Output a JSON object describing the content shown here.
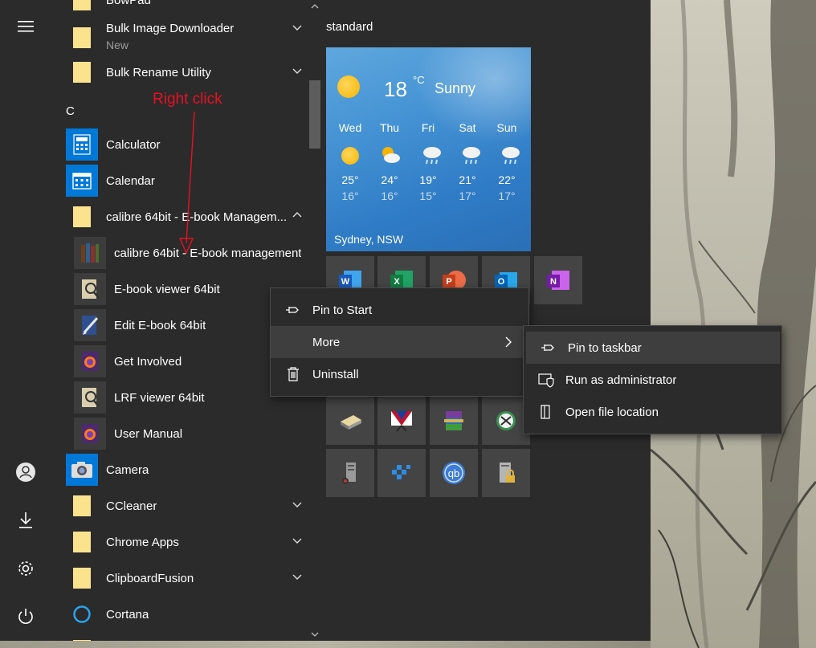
{
  "left_rail": {
    "menu_icon": "hamburger-icon",
    "account_icon": "user-icon",
    "downloads_icon": "download-icon",
    "settings_icon": "gear-icon",
    "power_icon": "power-icon"
  },
  "app_list": {
    "items": [
      {
        "label": "BowPad",
        "type": "folder",
        "chevron": false
      },
      {
        "label": "Bulk Image Downloader",
        "sublabel": "New",
        "type": "folder",
        "chevron": true
      },
      {
        "label": "Bulk Rename Utility",
        "type": "folder",
        "chevron": true
      },
      {
        "letter": "C"
      },
      {
        "label": "Calculator",
        "type": "app"
      },
      {
        "label": "Calendar",
        "type": "app"
      },
      {
        "label": "calibre 64bit - E-book Managem...",
        "type": "folder",
        "chevron": "up"
      },
      {
        "label": "calibre 64bit - E-book management",
        "type": "sub"
      },
      {
        "label": "E-book viewer 64bit",
        "type": "sub"
      },
      {
        "label": "Edit E-book 64bit",
        "type": "sub"
      },
      {
        "label": "Get Involved",
        "type": "sub"
      },
      {
        "label": "LRF viewer 64bit",
        "type": "sub"
      },
      {
        "label": "User Manual",
        "type": "sub"
      },
      {
        "label": "Camera",
        "type": "app"
      },
      {
        "label": "CCleaner",
        "type": "folder",
        "chevron": true
      },
      {
        "label": "Chrome Apps",
        "type": "folder",
        "chevron": true
      },
      {
        "label": "ClipboardFusion",
        "type": "folder",
        "chevron": true
      },
      {
        "label": "Cortana",
        "type": "app"
      }
    ]
  },
  "annotation": {
    "text": "Right click",
    "color": "#e81123"
  },
  "tiles": {
    "group_title": "standard",
    "weather": {
      "temp": "18",
      "unit": "°C",
      "condition": "Sunny",
      "location": "Sydney, NSW",
      "forecast": [
        {
          "day": "Wed",
          "icon": "sun-icon",
          "high": "25°",
          "low": "16°"
        },
        {
          "day": "Thu",
          "icon": "partly-cloudy-icon",
          "high": "24°",
          "low": "16°"
        },
        {
          "day": "Fri",
          "icon": "rain-cloud-icon",
          "high": "19°",
          "low": "15°"
        },
        {
          "day": "Sat",
          "icon": "rain-cloud-icon",
          "high": "21°",
          "low": "17°"
        },
        {
          "day": "Sun",
          "icon": "rain-cloud-icon",
          "high": "22°",
          "low": "17°"
        }
      ]
    },
    "office_tiles": [
      "word-icon",
      "excel-icon",
      "powerpoint-icon",
      "outlook-icon",
      "onenote-icon"
    ]
  },
  "context_menu": {
    "items": [
      "Pin to Start",
      "More",
      "Uninstall"
    ]
  },
  "submenu": {
    "items": [
      "Pin to taskbar",
      "Run as administrator",
      "Open file location"
    ]
  },
  "colors": {
    "menu_bg": "#2b2b2b",
    "folder": "#fbe38e",
    "accent_blue": "#0078d7",
    "highlight": "#3e3e3e"
  }
}
